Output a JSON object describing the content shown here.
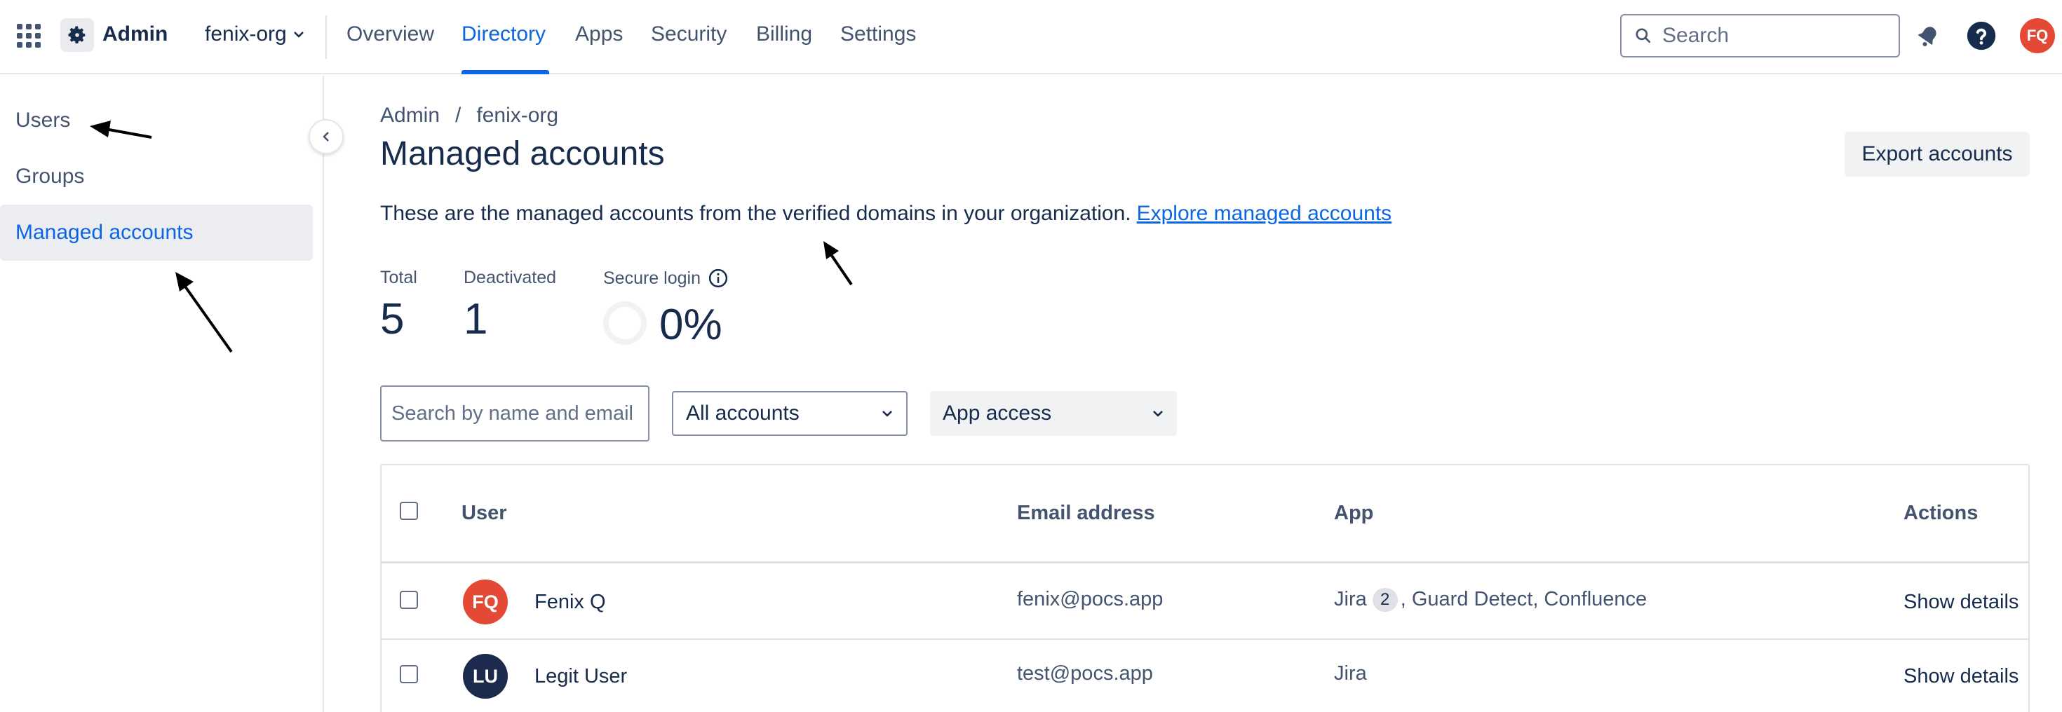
{
  "topnav": {
    "app_name": "Admin",
    "org": "fenix-org",
    "tabs": [
      {
        "label": "Overview"
      },
      {
        "label": "Directory"
      },
      {
        "label": "Apps"
      },
      {
        "label": "Security"
      },
      {
        "label": "Billing"
      },
      {
        "label": "Settings"
      }
    ],
    "active_tab": "Directory",
    "search_placeholder": "Search",
    "user_initials": "FQ",
    "accent_color": "#0c66e4"
  },
  "sidebar": {
    "items": [
      {
        "label": "Users"
      },
      {
        "label": "Groups"
      },
      {
        "label": "Managed accounts"
      }
    ],
    "active_item": "Managed accounts"
  },
  "main": {
    "breadcrumb": [
      "Admin",
      "fenix-org"
    ],
    "breadcrumb_separator": "/",
    "title": "Managed accounts",
    "export_label": "Export accounts",
    "description": "These are the managed accounts from the verified domains in your organization.",
    "description_link": "Explore managed accounts",
    "stats": {
      "total_label": "Total",
      "total_value": "5",
      "deactivated_label": "Deactivated",
      "deactivated_value": "1",
      "secure_label": "Secure login",
      "secure_value": "0%"
    },
    "filters": {
      "search_placeholder": "Search by name and email",
      "accounts_select": "All accounts",
      "app_select": "App access"
    },
    "table": {
      "headers": {
        "user": "User",
        "email": "Email address",
        "app": "App",
        "actions": "Actions"
      },
      "rows": [
        {
          "initials": "FQ",
          "avatar_color": "#e34935",
          "name": "Fenix Q",
          "email": "fenix@pocs.app",
          "app_first": "Jira",
          "app_badge": "2",
          "app_rest": ", Guard Detect, Confluence",
          "action": "Show details"
        },
        {
          "initials": "LU",
          "avatar_color": "#1c2b4d",
          "name": "Legit User",
          "email": "test@pocs.app",
          "app_first": "Jira",
          "app_badge": "",
          "app_rest": "",
          "action": "Show details"
        }
      ]
    }
  }
}
